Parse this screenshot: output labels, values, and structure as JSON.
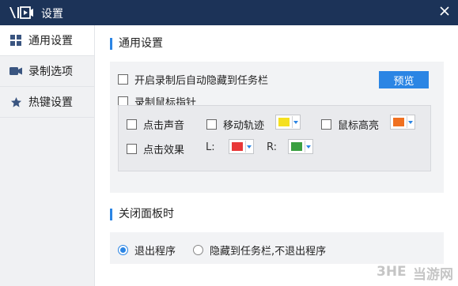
{
  "window": {
    "title": "设置",
    "close_icon": "close-icon",
    "logo_icon": "video-logo-icon"
  },
  "sidebar": {
    "items": [
      {
        "label": "通用设置",
        "icon": "grid-icon",
        "active": true
      },
      {
        "label": "录制选项",
        "icon": "video-camera-icon",
        "active": false
      },
      {
        "label": "热键设置",
        "icon": "star-icon",
        "active": false
      }
    ]
  },
  "general": {
    "title": "通用设置",
    "auto_hide_label": "开启录制后自动隐藏到任务栏",
    "preview_label": "预览",
    "record_cursor_label": "录制鼠标指针",
    "click_sound_label": "点击声音",
    "move_track_label": "移动轨迹",
    "move_track_color": "#f5e020",
    "highlight_label": "鼠标高亮",
    "highlight_color": "#f07020",
    "click_effect_label": "点击效果",
    "left_label": "L:",
    "left_color": "#e83838",
    "right_label": "R:",
    "right_color": "#3aa040"
  },
  "close_panel": {
    "title": "关闭面板时",
    "exit_label": "退出程序",
    "hide_label": "隐藏到任务栏,不退出程序",
    "selected": "exit"
  },
  "watermark": {
    "text": "当游网"
  },
  "colors": {
    "titlebar": "#1c3358",
    "accent": "#2b85e4"
  }
}
